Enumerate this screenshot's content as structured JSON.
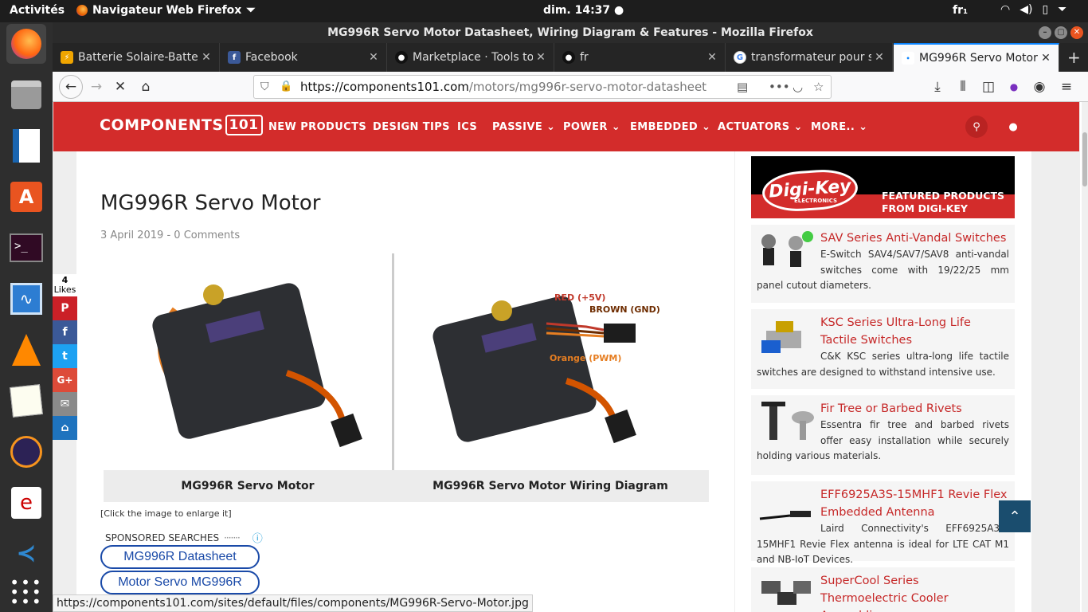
{
  "topbar": {
    "activities": "Activités",
    "app": "Navigateur Web Firefox",
    "clock": "dim. 14:37",
    "lang": "fr₁"
  },
  "window": {
    "title": "MG996R Servo Motor Datasheet, Wiring Diagram & Features - Mozilla Firefox"
  },
  "tabs": [
    {
      "label": "Batterie Solaire-Batter",
      "icon": "solar-favicon",
      "color": "#f0a500"
    },
    {
      "label": "Facebook",
      "icon": "facebook-favicon",
      "color": "#3b5998"
    },
    {
      "label": "Marketplace · Tools to",
      "icon": "github-favicon",
      "color": "#222"
    },
    {
      "label": "fr",
      "icon": "github-favicon",
      "color": "#222"
    },
    {
      "label": "transformateur pour s",
      "icon": "google-favicon",
      "color": "#4285f4"
    },
    {
      "label": "MG996R Servo Motor",
      "icon": "components101-favicon",
      "color": "#d32c2b"
    }
  ],
  "url": {
    "host": "https://components101.com",
    "path": "/motors/mg996r-servo-motor-datasheet"
  },
  "site": {
    "logo": "COMPONENTS",
    "logo_chip": "101",
    "menu": [
      "NEW PRODUCTS",
      "DESIGN TIPS",
      "ICS",
      "PASSIVE ⌄",
      "POWER ⌄",
      "EMBEDDED ⌄",
      "ACTUATORS ⌄",
      "MORE.. ⌄"
    ]
  },
  "article": {
    "title": "MG996R Servo Motor",
    "meta": "3 April 2019 - 0 Comments",
    "captions": [
      "MG996R Servo Motor",
      "MG996R Servo Motor Wiring Diagram"
    ],
    "wiring_labels": {
      "red": "RED (+5V)",
      "brown": "BROWN (GND)",
      "orange": "Orange (PWM)"
    },
    "note": "[Click the image to enlarge it]",
    "sponsored": "SPONSORED SEARCHES",
    "searches": [
      "MG996R Datasheet",
      "Motor Servo MG996R"
    ]
  },
  "share": {
    "count": "4",
    "label": "Likes"
  },
  "sidebar": {
    "banner_logo": "Digi-Key",
    "banner_sub": "ELECTRONICS",
    "banner_text": [
      "FEATURED PRODUCTS",
      "FROM DIGI-KEY"
    ],
    "cards": [
      {
        "title": "SAV Series Anti-Vandal Switches",
        "desc": "E-Switch SAV4/SAV7/SAV8 anti-vandal switches come with 19/22/25 mm panel cutout diameters."
      },
      {
        "title": "KSC Series Ultra-Long Life Tactile Switches",
        "desc": "C&K KSC series ultra-long life tactile switches are designed to withstand intensive use."
      },
      {
        "title": "Fir Tree or Barbed Rivets",
        "desc": "Essentra fir tree and barbed rivets offer easy installation while securely holding various materials."
      },
      {
        "title": "EFF6925A3S-15MHF1 Revie Flex Embedded Antenna",
        "desc": "Laird Connectivity's EFF6925A3S-15MHF1 Revie Flex antenna is ideal for LTE CAT M1 and NB-IoT Devices."
      },
      {
        "title": "SuperCool Series Thermoelectric Cooler Assemblies",
        "desc": ""
      }
    ]
  },
  "status": "https://components101.com/sites/default/files/components/MG996R-Servo-Motor.jpg"
}
